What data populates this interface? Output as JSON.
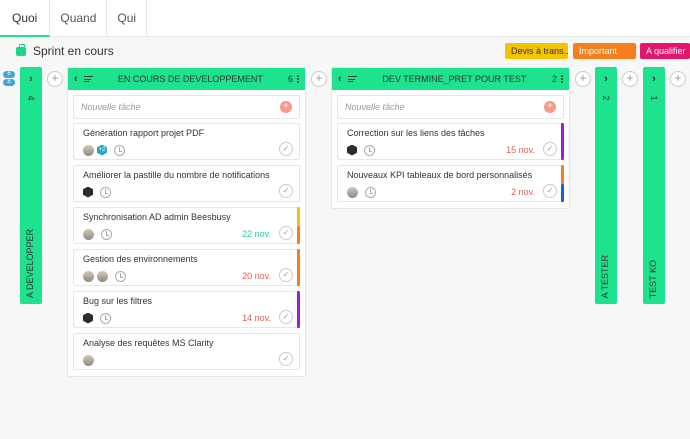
{
  "tabs": [
    {
      "label": "Quoi"
    },
    {
      "label": "Quand"
    },
    {
      "label": "Qui"
    }
  ],
  "sprint": {
    "title": "Sprint en cours"
  },
  "tags": [
    {
      "label": "Devis à trans...",
      "color": "#f5c400"
    },
    {
      "label": "Important",
      "color": "#f57e1e"
    },
    {
      "label": "A qualifier",
      "color": "#e5156c"
    }
  ],
  "collapsed_columns": [
    {
      "label": "A DEVELOPPER",
      "count": "4"
    },
    {
      "label": "A TESTER",
      "count": "2"
    },
    {
      "label": "TEST KO",
      "count": "1"
    }
  ],
  "columns": [
    {
      "title": "EN COURS DE DEVELOPPEMENT",
      "count": "6",
      "new_task_placeholder": "Nouvelle tâche",
      "cards": [
        {
          "title": "Génération rapport projet PDF",
          "date": "",
          "avatars": [
            "photo",
            "plus"
          ],
          "plus_label": "+2"
        },
        {
          "title": "Améliorer la pastille du nombre de notifications",
          "date": "",
          "avatars": [
            "dark"
          ]
        },
        {
          "title": "Synchronisation AD admin Beesbusy",
          "date": "22 nov.",
          "date_color": "#1ed68b",
          "avatars": [
            "photo"
          ],
          "stripes": [
            "#f5c400",
            "#f57e1e"
          ]
        },
        {
          "title": "Gestion des environnements",
          "date": "20 nov.",
          "date_color": "#e85a4f",
          "avatars": [
            "photo",
            "photo"
          ],
          "stripes": [
            "#f57e1e"
          ]
        },
        {
          "title": "Bug sur les filtres",
          "date": "14 nov.",
          "date_color": "#e85a4f",
          "avatars": [
            "dark"
          ],
          "stripes": [
            "#a11bd6"
          ]
        },
        {
          "title": "Analyse des requêtes MS Clarity",
          "date": "",
          "avatars": [
            "photo"
          ],
          "no_clock": true
        }
      ]
    },
    {
      "title": "DEV TERMINE_PRET POUR TEST",
      "count": "2",
      "new_task_placeholder": "Nouvelle tâche",
      "cards": [
        {
          "title": "Correction sur les liens des tâches",
          "date": "15 nov.",
          "date_color": "#e85a4f",
          "avatars": [
            "dark"
          ],
          "stripes": [
            "#a11bd6"
          ]
        },
        {
          "title": "Nouveaux KPI tableaux de bord personnalisés",
          "date": "2 nov.",
          "date_color": "#e85a4f",
          "avatars": [
            "photo"
          ],
          "stripes": [
            "#f57e1e",
            "#1a5fd6"
          ]
        }
      ]
    }
  ],
  "side_badges": [
    "6",
    "8"
  ],
  "icons": {
    "chevron_right": "›",
    "chevron_left": "‹",
    "plus": "+",
    "check": "✓"
  }
}
